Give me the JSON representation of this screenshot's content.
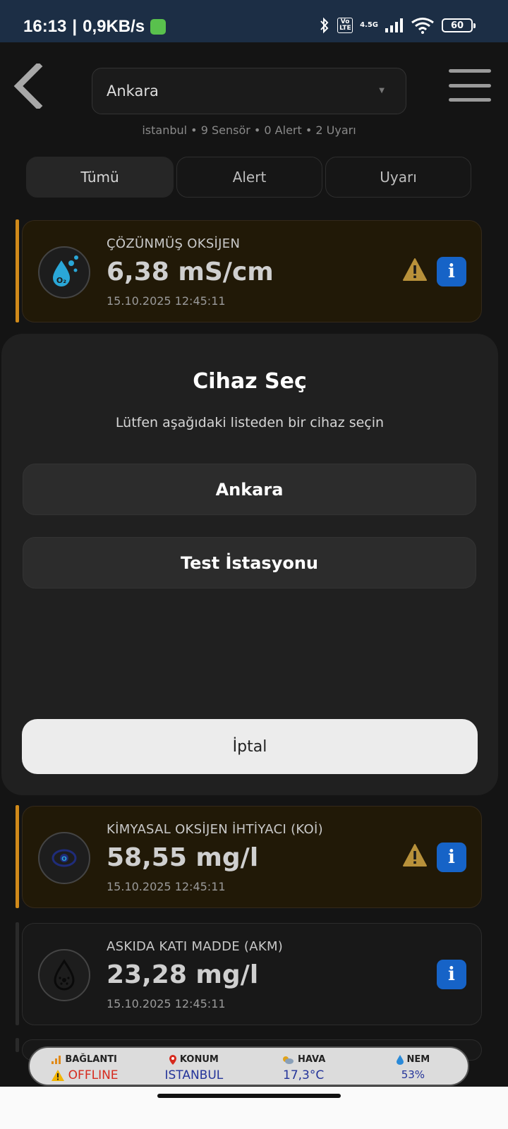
{
  "status_bar": {
    "time": "16:13",
    "speed": "0,9KB/s",
    "volte": "Vo LTE",
    "network": "4.5G",
    "battery": "60"
  },
  "header": {
    "selected_device": "Ankara",
    "summary": "istanbul • 9 Sensör • 0 Alert • 2 Uyarı"
  },
  "tabs": [
    {
      "label": "Tümü"
    },
    {
      "label": "Alert"
    },
    {
      "label": "Uyarı"
    }
  ],
  "sensors": [
    {
      "name": "ÇÖZÜNMÜŞ OKSİJEN",
      "value": "6,38 mS/cm",
      "time": "15.10.2025 12:45:11",
      "status": "warning",
      "icon": "o2-drop-icon"
    },
    {
      "name": "KİMYASAL OKSİJEN İHTİYACI (KOİ)",
      "value": "58,55 mg/l",
      "time": "15.10.2025 12:45:11",
      "status": "warning",
      "icon": "cod-sensor-icon"
    },
    {
      "name": "ASKIDA KATI MADDE (AKM)",
      "value": "23,28 mg/l",
      "time": "15.10.2025 12:45:11",
      "status": "normal",
      "icon": "particle-drop-icon"
    }
  ],
  "modal": {
    "title": "Cihaz Seç",
    "subtitle": "Lütfen aşağıdaki listeden bir cihaz seçin",
    "options": [
      {
        "label": "Ankara"
      },
      {
        "label": "Test İstasyonu"
      }
    ],
    "cancel_label": "İptal"
  },
  "bottom_bar": {
    "connection": {
      "label": "BAĞLANTI",
      "value": "OFFLINE"
    },
    "location": {
      "label": "KONUM",
      "value": "ISTANBUL"
    },
    "weather": {
      "label": "HAVA",
      "value": "17,3°C"
    },
    "humidity": {
      "label": "NEM",
      "value": "53%"
    }
  },
  "colors": {
    "warning_rail": "#d08a1a",
    "info_blue": "#1663c7",
    "offline_red": "#d62a1e",
    "bar_value_blue": "#24349a"
  }
}
